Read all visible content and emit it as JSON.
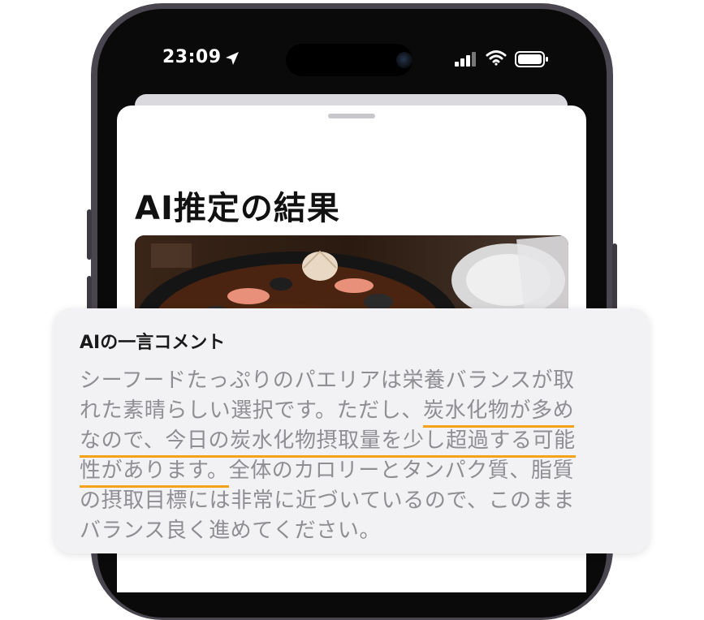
{
  "status_bar": {
    "time": "23:09",
    "icons": [
      "location-arrow-icon",
      "cellular-signal-icon",
      "wifi-icon",
      "battery-icon"
    ]
  },
  "sheet": {
    "title": "AI推定の結果",
    "photo": "paella-photo"
  },
  "comment": {
    "title": "AIの一言コメント",
    "lines": [
      {
        "parts": [
          {
            "text": "シーフードたっぷりのパエリアは栄養バランスが取",
            "highlight": false
          }
        ]
      },
      {
        "parts": [
          {
            "text": "れた素晴らしい選択です。ただし、",
            "highlight": false
          },
          {
            "text": "炭水化物が多め",
            "highlight": true
          }
        ]
      },
      {
        "parts": [
          {
            "text": "なので、今日の炭水化物摂取量を少し超過する可能",
            "highlight": true
          }
        ]
      },
      {
        "parts": [
          {
            "text": "性があります。",
            "highlight": true
          },
          {
            "text": "全体のカロリーとタンパク質、脂質",
            "highlight": false
          }
        ]
      },
      {
        "parts": [
          {
            "text": "の摂取目標には非常に近づいているので、このまま",
            "highlight": false
          }
        ]
      },
      {
        "parts": [
          {
            "text": "バランス良く進めてください。",
            "highlight": false
          }
        ]
      }
    ]
  },
  "colors": {
    "highlight_underline": "#f5a21b",
    "comment_text": "#8e8e93",
    "card_background": "#f2f2f4",
    "phone_frame": "#4a4650"
  }
}
